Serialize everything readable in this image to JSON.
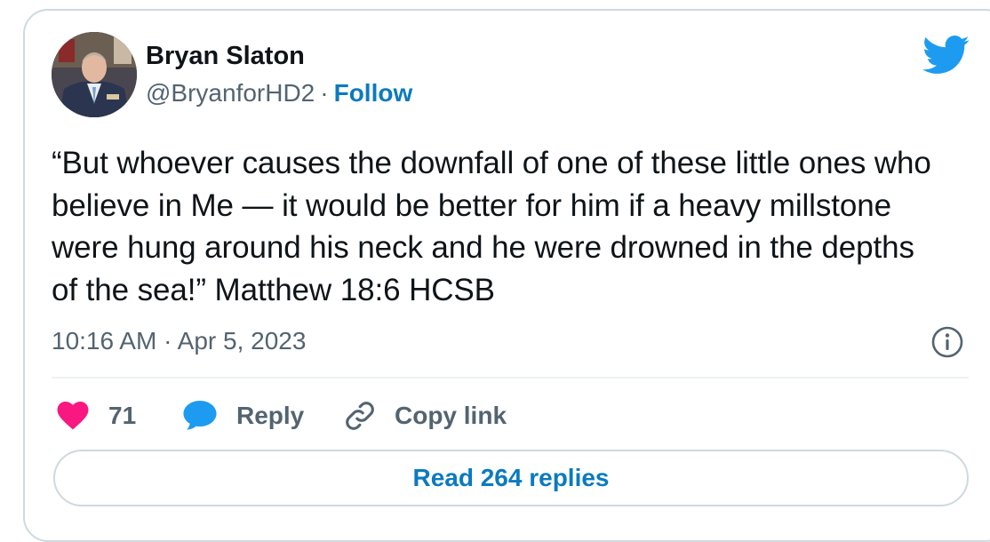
{
  "author": {
    "name": "Bryan Slaton",
    "handle": "@BryanforHD2",
    "separator": "·",
    "follow_label": "Follow"
  },
  "tweet": {
    "text": "“But whoever causes the downfall of one of these little ones who believe in Me — it would be better for him if a heavy millstone were hung around his neck and he were drowned in the depths of the sea!” Matthew 18:6 HCSB",
    "timestamp": "10:16 AM · Apr 5, 2023"
  },
  "actions": {
    "like_count": "71",
    "reply_label": "Reply",
    "copy_link_label": "Copy link"
  },
  "read_replies_label": "Read 264 replies",
  "icons": {
    "brand": "twitter-bird-icon",
    "like": "heart-icon",
    "reply": "speech-bubble-icon",
    "copy": "link-icon",
    "info": "info-icon"
  },
  "colors": {
    "accent": "#1d9bf0",
    "link": "#0c7abf",
    "heart": "#f91880",
    "text": "#0f1419",
    "muted": "#536471",
    "border": "#cfd9de"
  }
}
